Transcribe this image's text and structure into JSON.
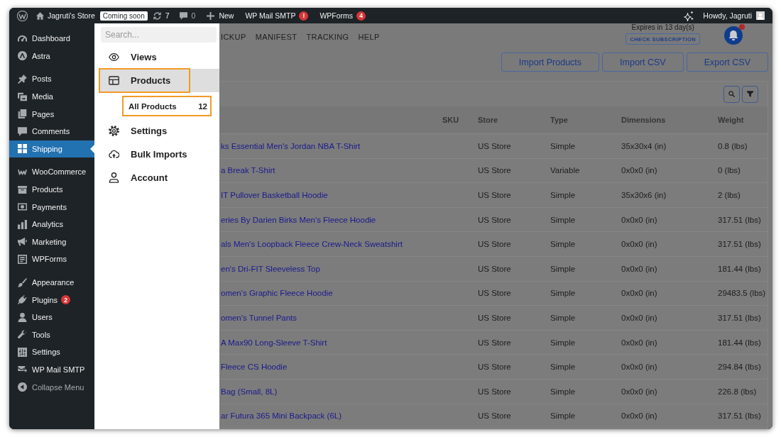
{
  "admin_bar": {
    "site": "Jagruti's Store",
    "site_status": "Coming soon",
    "updates": "7",
    "comments": "0",
    "new": "New",
    "plugins": [
      {
        "label": "WP Mail SMTP",
        "badge": "!"
      },
      {
        "label": "WPForms",
        "badge": "4"
      }
    ],
    "greeting": "Howdy, Jagruti"
  },
  "sidebar": {
    "groups": [
      {
        "items": [
          {
            "label": "Dashboard",
            "selected": false
          },
          {
            "label": "Astra",
            "selected": false
          }
        ]
      },
      {
        "items": [
          {
            "label": "Posts",
            "selected": false
          },
          {
            "label": "Media",
            "selected": false
          },
          {
            "label": "Pages",
            "selected": false
          },
          {
            "label": "Comments",
            "selected": false
          },
          {
            "label": "Shipping",
            "selected": true
          }
        ]
      },
      {
        "items": [
          {
            "label": "WooCommerce",
            "selected": false
          },
          {
            "label": "Products",
            "selected": false
          },
          {
            "label": "Payments",
            "selected": false
          },
          {
            "label": "Analytics",
            "selected": false
          },
          {
            "label": "Marketing",
            "selected": false
          },
          {
            "label": "WPForms",
            "selected": false
          }
        ]
      },
      {
        "items": [
          {
            "label": "Appearance",
            "selected": false
          },
          {
            "label": "Plugins",
            "selected": false,
            "badge": "2"
          },
          {
            "label": "Users",
            "selected": false
          },
          {
            "label": "Tools",
            "selected": false
          },
          {
            "label": "Settings",
            "selected": false
          },
          {
            "label": "WP Mail SMTP",
            "selected": false
          }
        ]
      }
    ],
    "collapse": "Collapse Menu"
  },
  "panel": {
    "search": {
      "placeholder": "Search..."
    },
    "items": [
      {
        "label": "Views",
        "selected": false,
        "highlighted": false
      },
      {
        "label": "Products",
        "selected": true,
        "highlighted": true,
        "children": [
          {
            "label": "All Products",
            "count": "12",
            "highlighted": true
          }
        ]
      },
      {
        "label": "Settings",
        "selected": false,
        "highlighted": false
      },
      {
        "label": "Bulk Imports",
        "selected": false,
        "highlighted": false
      },
      {
        "label": "Account",
        "selected": false,
        "highlighted": false
      }
    ]
  },
  "main": {
    "nav_tabs": [
      "ICKUP",
      "MANIFEST",
      "TRACKING",
      "HELP"
    ],
    "subscription": {
      "expires": "Expires in 13 day(s)",
      "button": "CHECK SUBSCRIPTION"
    },
    "notifications": {
      "unread": true
    },
    "actions": [
      "Import Products",
      "Import CSV",
      "Export CSV"
    ],
    "table": {
      "columns": [
        "SKU",
        "Store",
        "Type",
        "Dimensions",
        "Weight"
      ],
      "rows": [
        {
          "product": "ks Essential Men's Jordan NBA T-Shirt",
          "store": "US Store",
          "type": "Simple",
          "dimensions": "35x30x4 (in)",
          "weight": "0.8 (lbs)"
        },
        {
          "product": "a Break T-Shirt",
          "store": "US Store",
          "type": "Variable",
          "dimensions": "0x0x0 (in)",
          "weight": "0 (lbs)"
        },
        {
          "product": "IT Pullover Basketball Hoodie",
          "store": "US Store",
          "type": "Simple",
          "dimensions": "35x30x6 (in)",
          "weight": "2 (lbs)"
        },
        {
          "product": "eries By Darien Birks Men's Fleece Hoodie",
          "store": "US Store",
          "type": "Simple",
          "dimensions": "0x0x0 (in)",
          "weight": "317.51 (lbs)"
        },
        {
          "product": "als Men's Loopback Fleece Crew-Neck Sweatshirt",
          "store": "US Store",
          "type": "Simple",
          "dimensions": "0x0x0 (in)",
          "weight": "317.51 (lbs)"
        },
        {
          "product": "en's Dri-FIT Sleeveless Top",
          "store": "US Store",
          "type": "Simple",
          "dimensions": "0x0x0 (in)",
          "weight": "181.44 (lbs)"
        },
        {
          "product": "omen's Graphic Fleece Hoodie",
          "store": "US Store",
          "type": "Simple",
          "dimensions": "0x0x0 (in)",
          "weight": "29483.5 (lbs)"
        },
        {
          "product": "omen's Tunnel Pants",
          "store": "US Store",
          "type": "Simple",
          "dimensions": "0x0x0 (in)",
          "weight": "317.51 (lbs)"
        },
        {
          "product": "A Max90 Long-Sleeve T-Shirt",
          "store": "US Store",
          "type": "Simple",
          "dimensions": "0x0x0 (in)",
          "weight": "181.44 (lbs)"
        },
        {
          "product": "Fleece CS Hoodie",
          "store": "US Store",
          "type": "Simple",
          "dimensions": "0x0x0 (in)",
          "weight": "294.84 (lbs)"
        },
        {
          "product": "Bag (Small, 8L)",
          "store": "US Store",
          "type": "Simple",
          "dimensions": "0x0x0 (in)",
          "weight": "226.8 (lbs)"
        },
        {
          "product": "ar Futura 365 Mini Backpack (6L)",
          "store": "US Store",
          "type": "Simple",
          "dimensions": "0x0x0 (in)",
          "weight": "317.51 (lbs)"
        }
      ]
    }
  }
}
